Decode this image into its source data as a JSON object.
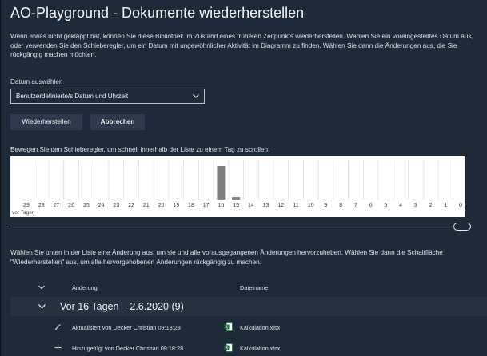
{
  "page": {
    "title": "AO-Playground - Dokumente wiederherstellen",
    "intro": "Wenn etwas nicht geklappt hat, können Sie diese Bibliothek im Zustand eines früheren Zeitpunkts wiederherstellen. Wählen Sie ein voreingestelltes Datum aus, oder verwenden Sie den Schieberegler, um ein Datum mit ungewöhnlicher Aktivität im Diagramm zu finden. Wählen Sie dann die Änderungen aus, die Sie rückgängig machen möchten."
  },
  "date_select": {
    "label": "Datum auswählen",
    "value": "Benutzerdefinierte/s Datum und Uhrzeit"
  },
  "buttons": {
    "restore": "Wiederherstellen",
    "cancel": "Abbrechen"
  },
  "slider": {
    "instruction": "Bewegen Sie den Schieberegler, um schnell innerhalb der Liste zu einem Tag zu scrollen.",
    "position": 1.0
  },
  "chart_data": {
    "type": "bar",
    "categories": [
      "29",
      "28",
      "27",
      "26",
      "25",
      "24",
      "23",
      "22",
      "21",
      "20",
      "19",
      "18",
      "17",
      "16",
      "15",
      "14",
      "13",
      "12",
      "11",
      "10",
      "9",
      "8",
      "7",
      "6",
      "5",
      "4",
      "3",
      "2",
      "1",
      "0"
    ],
    "values": [
      0,
      0,
      0,
      0,
      0,
      0,
      0,
      0,
      0,
      0,
      0,
      0,
      0,
      100,
      7,
      0,
      0,
      0,
      0,
      0,
      0,
      0,
      0,
      0,
      0,
      0,
      0,
      0,
      0,
      0
    ],
    "xlabel": "vor Tagen",
    "ylim": [
      0,
      100
    ],
    "colors": {
      "bar": "#7f7f7f",
      "grid": "#d5d5d5"
    }
  },
  "list": {
    "instruction": "Wählen Sie unten in der Liste eine Änderung aus, um sie und alle vorausgegangenen Änderungen hervorzuheben. Wählen Sie dann die Schaltfläche \"Wiederherstellen\" aus, um alle hervorgehobenen Änderungen rückgängig zu machen.",
    "col_change": "Änderung",
    "col_file": "Dateiname",
    "group_title": "Vor 16 Tagen – 2.6.2020 (9)",
    "rows": [
      {
        "icon": "pencil-icon",
        "change": "Aktualisiert von Decker Christian 09:18:29",
        "file": "Kalkulation.xlsx"
      },
      {
        "icon": "plus-icon",
        "change": "Hinzugefügt von Decker Christian 09:18:28",
        "file": "Kalkulation.xlsx"
      }
    ]
  }
}
